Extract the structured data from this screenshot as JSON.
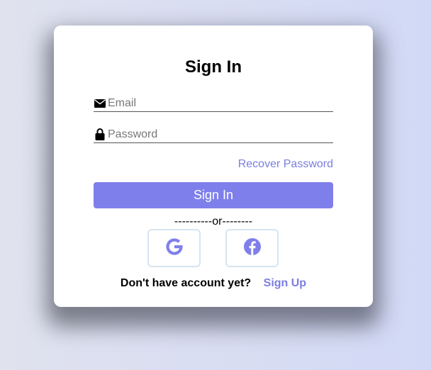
{
  "form": {
    "title": "Sign In",
    "email": {
      "placeholder": "Email",
      "icon": "envelope-icon"
    },
    "password": {
      "placeholder": "Password",
      "icon": "lock-icon"
    },
    "recover_label": "Recover Password",
    "submit_label": "Sign In",
    "divider_text": "----------or--------",
    "social": [
      {
        "name": "google",
        "icon": "google-icon"
      },
      {
        "name": "facebook",
        "icon": "facebook-icon"
      }
    ],
    "footer": {
      "prompt": "Don't have account yet?",
      "signup_label": "Sign Up"
    }
  },
  "colors": {
    "accent": "#7f7fec",
    "link": "#7a7ee0",
    "social_border": "#d7e4f1"
  }
}
